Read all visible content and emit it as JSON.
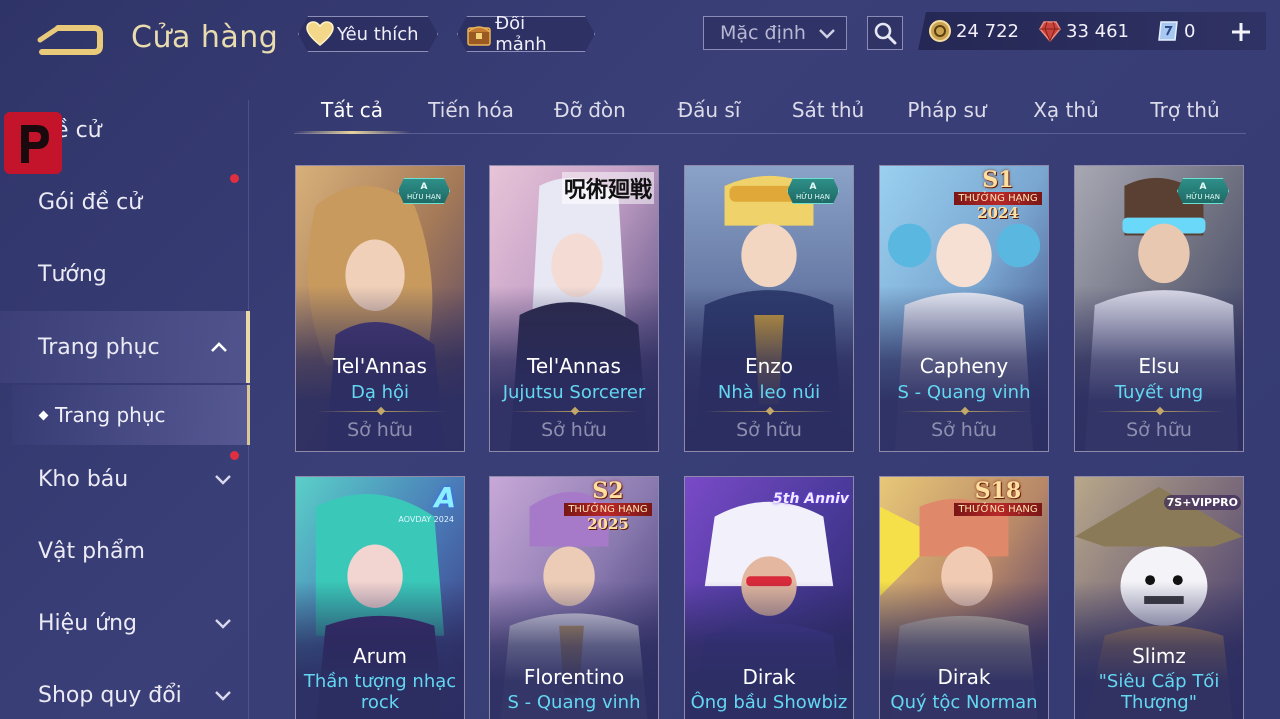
{
  "header": {
    "title": "Cửa hàng",
    "favorite_label": "Yêu thích",
    "shard_label": "Đổi mảnh",
    "sort_value": "Mặc định",
    "currencies": {
      "gold": "24 722",
      "ruby": "33 461",
      "voucher": "0"
    }
  },
  "sidebar": {
    "items": [
      {
        "label": "Đề cử"
      },
      {
        "label": "Gói đề cử"
      },
      {
        "label": "Tướng"
      },
      {
        "label": "Trang phục"
      },
      {
        "label": "Trang phục"
      },
      {
        "label": "Kho báu"
      },
      {
        "label": "Vật phẩm"
      },
      {
        "label": "Hiệu ứng"
      },
      {
        "label": "Shop quy đổi"
      }
    ]
  },
  "tabs": [
    "Tất cả",
    "Tiến hóa",
    "Đỡ đòn",
    "Đấu sĩ",
    "Sát thủ",
    "Pháp sư",
    "Xạ thủ",
    "Trợ thủ"
  ],
  "cards": [
    {
      "hero": "Tel'Annas",
      "skin": "Dạ hội",
      "status": "Sở hữu",
      "badge": "A HỮU HẠN"
    },
    {
      "hero": "Tel'Annas",
      "skin": "Jujutsu Sorcerer",
      "status": "Sở hữu",
      "badge": "呪術廻戦"
    },
    {
      "hero": "Enzo",
      "skin": "Nhà leo núi",
      "status": "Sở hữu",
      "badge": "A HỮU HẠN"
    },
    {
      "hero": "Capheny",
      "skin": "S - Quang vinh",
      "status": "Sở hữu",
      "badge": "S1 THƯỞNG HẠNG 2024"
    },
    {
      "hero": "Elsu",
      "skin": "Tuyết ưng",
      "status": "Sở hữu",
      "badge": "A HỮU HẠN"
    },
    {
      "hero": "Arum",
      "skin": "Thần tượng nhạc rock",
      "badge": "A AOVDAY 2024"
    },
    {
      "hero": "Florentino",
      "skin": "S - Quang vinh",
      "badge": "S2 THƯỞNG HẠNG 2025"
    },
    {
      "hero": "Dirak",
      "skin": "Ông bầu Showbiz",
      "badge": "5th Anniv"
    },
    {
      "hero": "Dirak",
      "skin": "Quý tộc Norman",
      "badge": "S18 THƯỞNG HẠNG"
    },
    {
      "hero": "Slimz",
      "skin": "\"Siêu Cấp Tối Thượng\"",
      "badge": "7S+VIPPRO"
    }
  ],
  "badges": {
    "a_letter": "A",
    "limited": "HỮU HẠN",
    "rank_label": "THƯỞNG HẠNG",
    "s1": "S1",
    "y2024": "2024",
    "s2": "S2",
    "y2025": "2025",
    "s18": "S18",
    "jjk": "呪術廻戦",
    "aovday": "AOVDAY 2024",
    "anniv": "5th Anniv",
    "vip": "7S+VIPPRO"
  },
  "colors": {
    "background": "#353a72",
    "title_gold": "#e9dcae",
    "skin_cyan": "#63d7f2",
    "owned_gray": "#8e8fae",
    "notification_red": "#e03040",
    "brand_logo_red": "#c4142c"
  },
  "icons": {
    "back": "back-arrow-icon",
    "favorite": "heart-icon",
    "shard": "shard-chest-icon",
    "search": "search-icon",
    "gold": "gold-coin-icon",
    "ruby": "ruby-gem-icon",
    "voucher": "voucher-icon",
    "add": "plus-icon"
  }
}
